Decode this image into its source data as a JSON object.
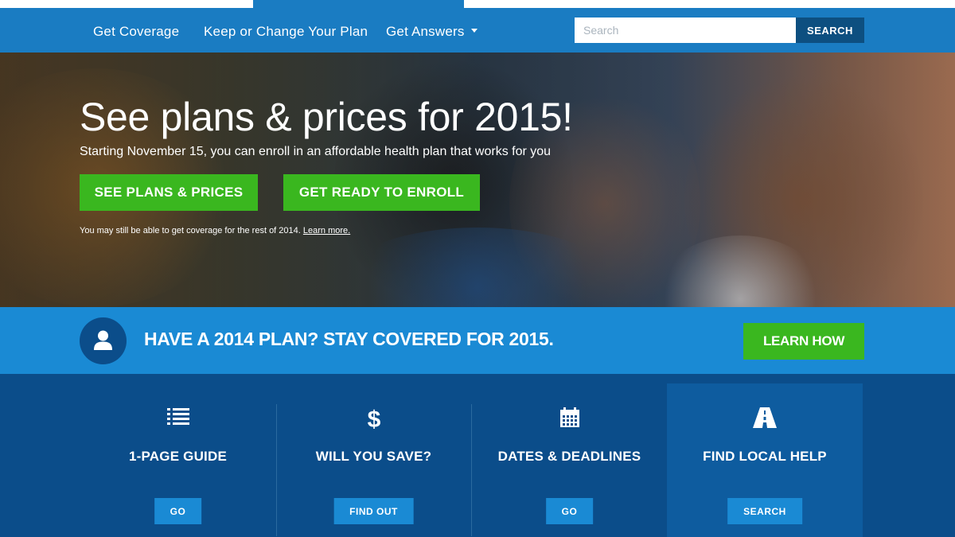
{
  "nav": {
    "items": [
      {
        "label": "Get Coverage"
      },
      {
        "label": "Keep or Change Your Plan"
      },
      {
        "label": "Get Answers"
      }
    ],
    "search_placeholder": "Search",
    "search_button": "SEARCH"
  },
  "hero": {
    "title": "See plans & prices for 2015!",
    "subtitle": "Starting November 15, you can enroll in an affordable health plan that works for you",
    "button_primary": "SEE PLANS & PRICES",
    "button_secondary": "GET READY TO ENROLL",
    "note_text": "You may still be able to get coverage for the rest of 2014.",
    "note_link": "Learn more."
  },
  "banner": {
    "text": "HAVE A 2014 PLAN? STAY COVERED FOR 2015.",
    "button": "LEARN HOW",
    "icon": "person-icon"
  },
  "tiles": [
    {
      "icon": "list-icon",
      "label": "1-PAGE GUIDE",
      "button": "GO"
    },
    {
      "icon": "dollar-icon",
      "label": "WILL YOU SAVE?",
      "button": "FIND OUT"
    },
    {
      "icon": "calendar-icon",
      "label": "DATES & DEADLINES",
      "button": "GO"
    },
    {
      "icon": "road-icon",
      "label": "FIND LOCAL HELP",
      "button": "SEARCH"
    }
  ],
  "colors": {
    "nav_blue": "#1a7cc2",
    "banner_blue": "#1a8ad4",
    "dark_blue": "#0b4d8a",
    "green": "#3ab71f"
  }
}
